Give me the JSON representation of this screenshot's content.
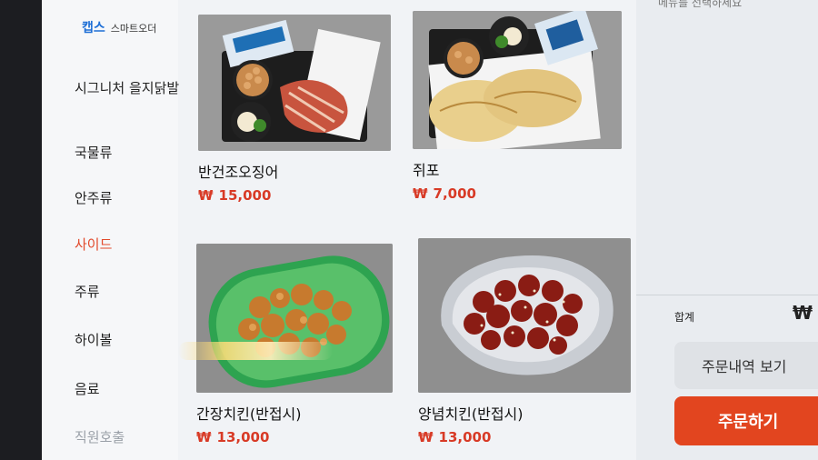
{
  "brand": {
    "logo": "캡스",
    "subtitle": "스마트오더"
  },
  "sidebar": {
    "items": [
      {
        "label": "시그니처 을지닭발",
        "state": "normal"
      },
      {
        "label": "국물류",
        "state": "normal"
      },
      {
        "label": "안주류",
        "state": "normal"
      },
      {
        "label": "사이드",
        "state": "active"
      },
      {
        "label": "주류",
        "state": "normal"
      },
      {
        "label": "하이볼",
        "state": "normal"
      },
      {
        "label": "음료",
        "state": "normal"
      },
      {
        "label": "직원호출",
        "state": "muted"
      }
    ]
  },
  "products": [
    {
      "name": "반건조오징어",
      "currency": "₩",
      "price": "15,000"
    },
    {
      "name": "쥐포",
      "currency": "₩",
      "price": "7,000"
    },
    {
      "name": "간장치킨(반접시)",
      "currency": "₩",
      "price": "13,000"
    },
    {
      "name": "양념치킨(반접시)",
      "currency": "₩",
      "price": "13,000"
    }
  ],
  "cart": {
    "top_hint": "메뉴를 선택하세요",
    "total_label": "합계",
    "total_currency": "₩",
    "history_button": "주문내역 보기",
    "order_button": "주문하기"
  },
  "colors": {
    "accent": "#e2451f",
    "price": "#d83a26",
    "brand": "#1f6fd6"
  }
}
